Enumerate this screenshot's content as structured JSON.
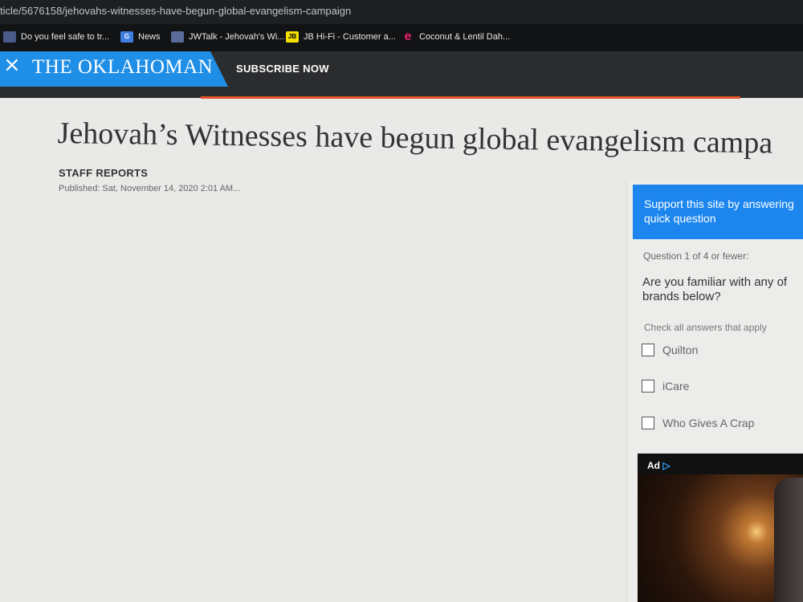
{
  "browser": {
    "url": "ticle/5676158/jehovahs-witnesses-have-begun-global-evangelism-campaign",
    "bookmarks": [
      {
        "label": "Do you feel safe to tr...",
        "icon": "bookmark-favicon"
      },
      {
        "label": "News",
        "icon": "news-favicon"
      },
      {
        "label": "JWTalk - Jehovah's Wi...",
        "icon": "jwtalk-favicon"
      },
      {
        "label": "JB Hi-Fi - Customer a...",
        "icon": "jbhifi-favicon"
      },
      {
        "label": "Coconut & Lentil Dah...",
        "icon": "e-favicon"
      }
    ]
  },
  "header": {
    "brand": "THE OKLAHOMAN",
    "close_icon": "×",
    "subscribe": "SUBSCRIBE NOW",
    "brand_color": "#1f8ee6",
    "accent_color": "#e8542a"
  },
  "article": {
    "title": "Jehovah’s Witnesses have begun global evangelism campa",
    "byline": "STAFF REPORTS",
    "published": "Published: Sat, November 14, 2020 2:01 AM..."
  },
  "survey": {
    "header_line1": "Support this site by answering",
    "header_line2": "quick question",
    "question_number": "Question 1 of 4 or fewer:",
    "question_line1": "Are you familiar with any of",
    "question_line2": "brands below?",
    "instruction": "Check all answers that apply",
    "options": [
      "Quilton",
      "iCare",
      "Who Gives A Crap"
    ]
  },
  "ad": {
    "label": "Ad",
    "icon": "▷"
  }
}
